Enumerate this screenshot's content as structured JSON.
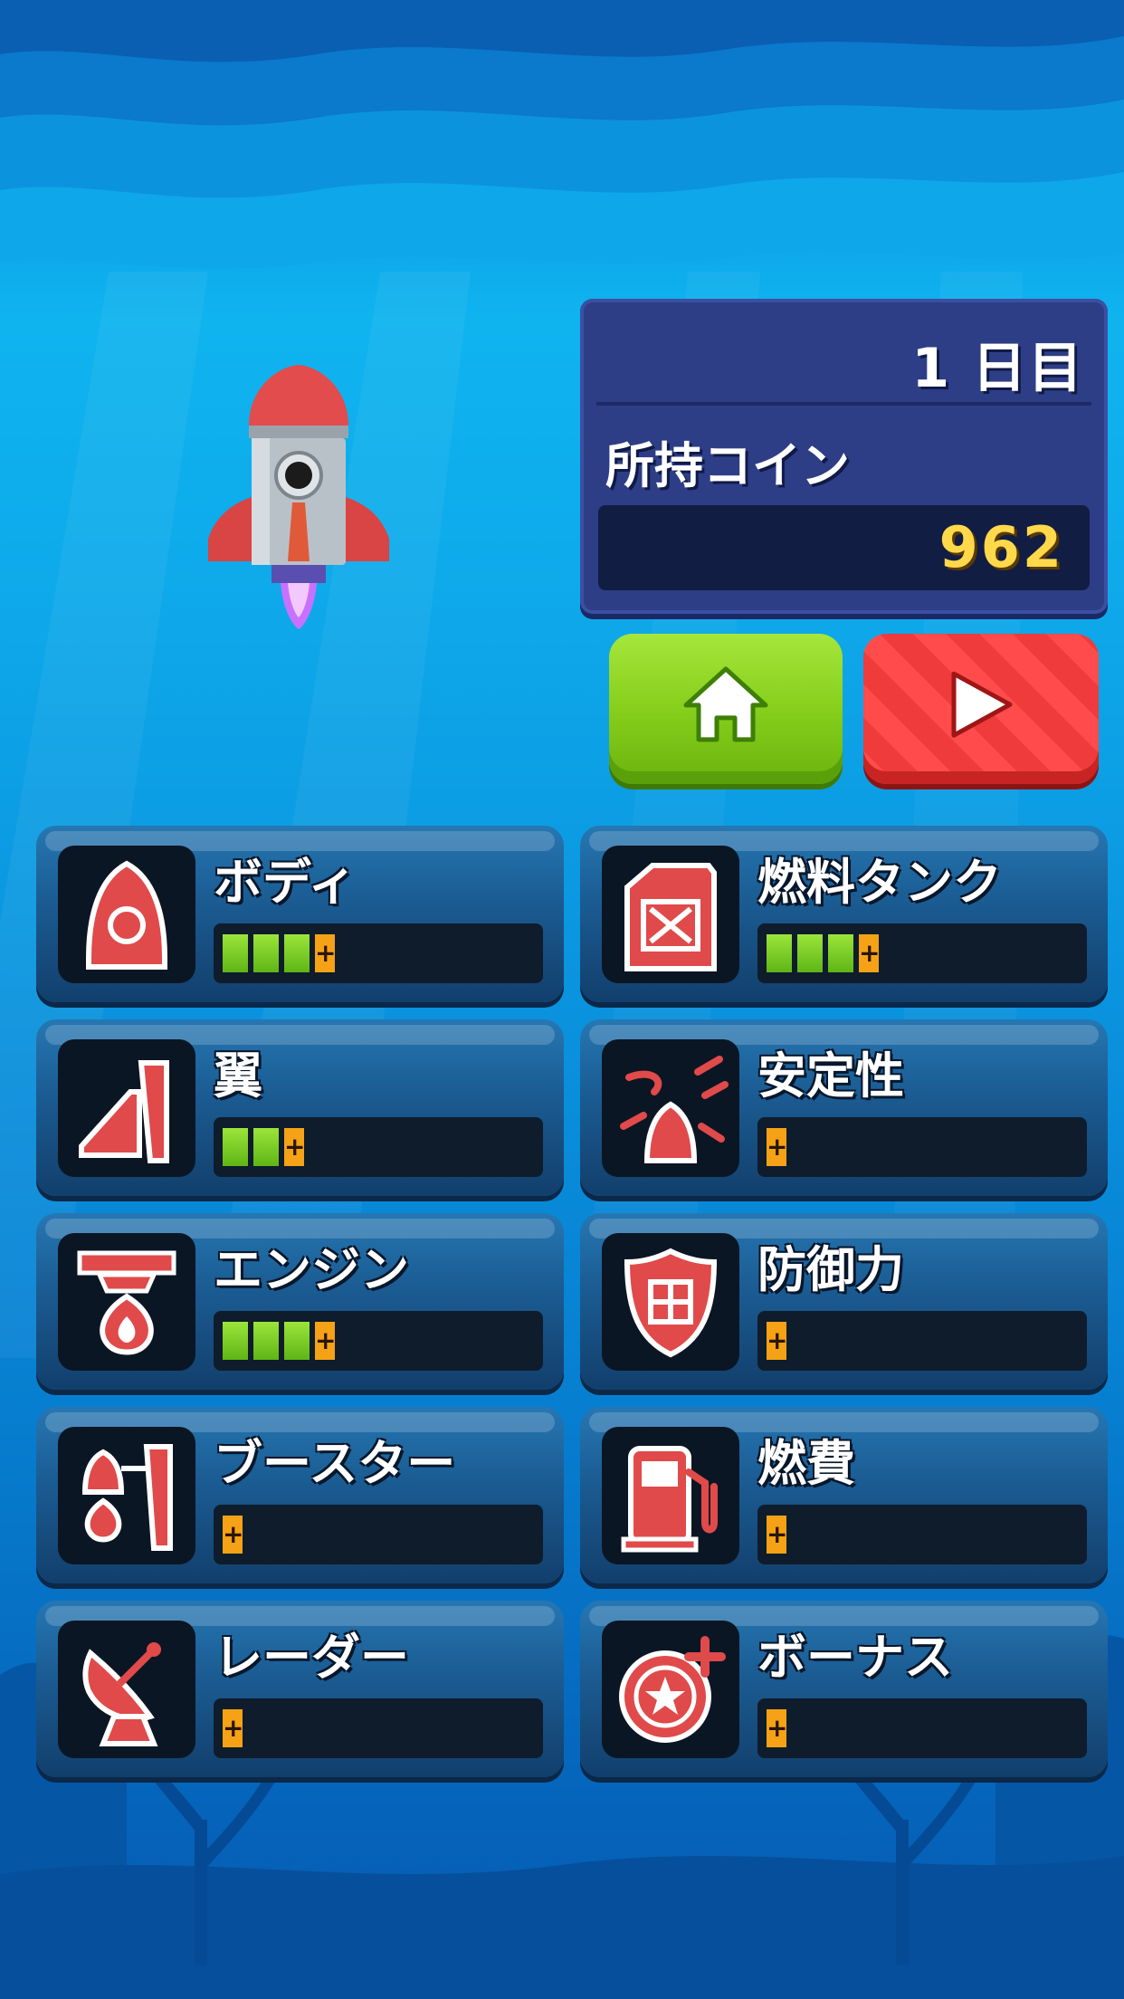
{
  "status": {
    "day": "1 日目",
    "coin_label": "所持コイン",
    "coin_value": "962"
  },
  "buttons": {
    "home_icon": "home-icon",
    "play_icon": "play-icon"
  },
  "upgrades": [
    {
      "name": "ボディ",
      "icon": "rocket-body-icon",
      "level": 3
    },
    {
      "name": "燃料タンク",
      "icon": "fuel-can-icon",
      "level": 3
    },
    {
      "name": "翼",
      "icon": "wing-icon",
      "level": 2
    },
    {
      "name": "安定性",
      "icon": "stability-icon",
      "level": 0
    },
    {
      "name": "エンジン",
      "icon": "engine-icon",
      "level": 3
    },
    {
      "name": "防御力",
      "icon": "shield-icon",
      "level": 0
    },
    {
      "name": "ブースター",
      "icon": "booster-icon",
      "level": 0
    },
    {
      "name": "燃費",
      "icon": "fuel-pump-icon",
      "level": 0
    },
    {
      "name": "レーダー",
      "icon": "radar-icon",
      "level": 0
    },
    {
      "name": "ボーナス",
      "icon": "bonus-coin-icon",
      "level": 0
    }
  ],
  "plus_glyph": "+",
  "colors": {
    "panel": "#2d3e86",
    "coin": "#ffd94a",
    "home_button": "#84cc1a",
    "play_button": "#ff4b4b",
    "bar_filled": "#7fd12a",
    "plus_box": "#f5a216",
    "icon_red": "#e04a4a"
  }
}
